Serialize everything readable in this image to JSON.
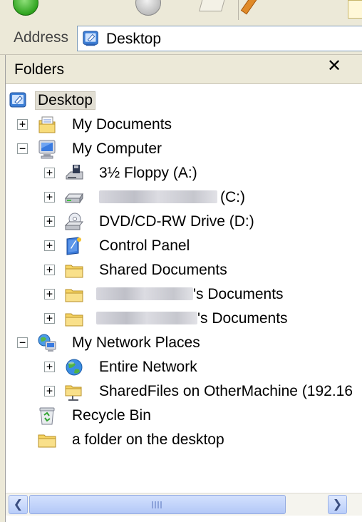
{
  "address_bar": {
    "label": "Address",
    "value": "Desktop",
    "icon": "desktop-icon"
  },
  "folders_pane": {
    "title": "Folders",
    "close_label": "✕",
    "tree": {
      "desktop": "Desktop",
      "my_documents": "My Documents",
      "my_computer": "My Computer",
      "floppy": "3½ Floppy (A:)",
      "local_disk": "(C:)",
      "dvd_drive": "DVD/CD-RW Drive (D:)",
      "control_panel": "Control Panel",
      "shared_documents": "Shared Documents",
      "user_documents_1": "'s Documents",
      "user_documents_2": "'s Documents",
      "my_network_places": "My Network Places",
      "entire_network": "Entire Network",
      "shared_files": "SharedFiles on OtherMachine (192.16",
      "recycle_bin": "Recycle Bin",
      "desktop_folder": "a folder on the desktop"
    },
    "expander_plus": "+",
    "expander_minus": "−"
  },
  "scrollbar": {
    "left_arrow": "❮",
    "right_arrow": "❯"
  },
  "colors": {
    "chrome": "#ece9d8",
    "selection": "#e1ded3",
    "scroll_blue": "#b9cdfa",
    "folder_yellow": "#f6d463"
  }
}
